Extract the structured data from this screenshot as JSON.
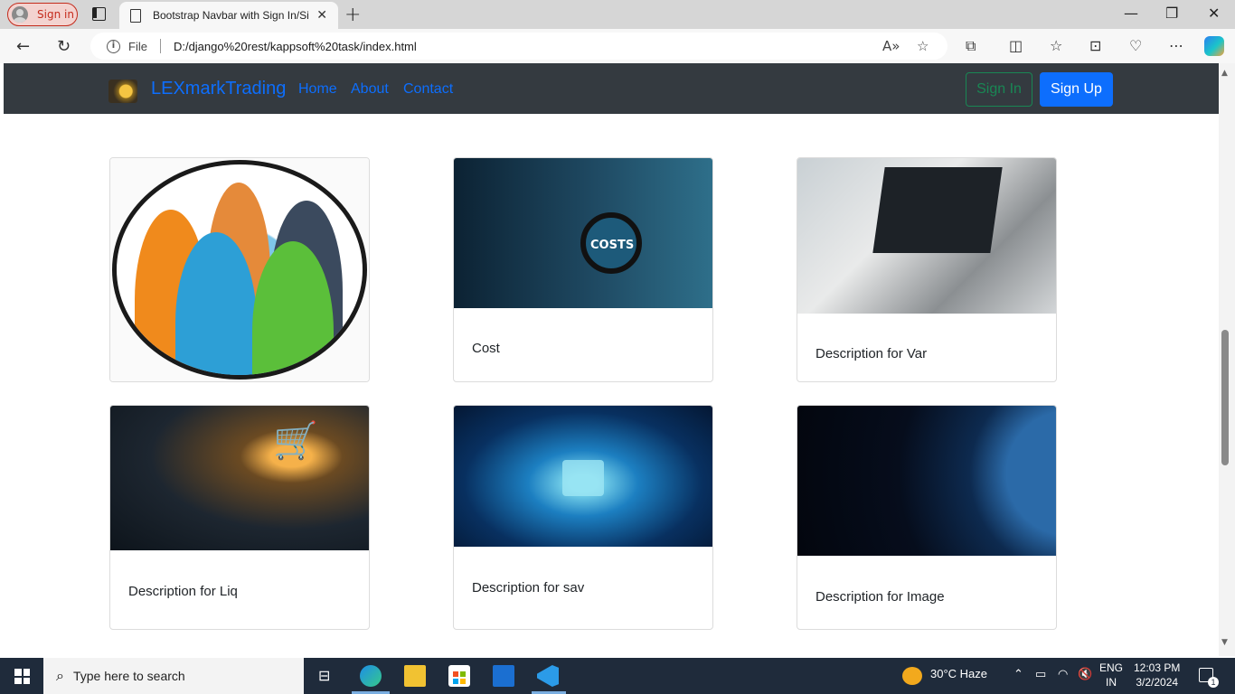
{
  "browser": {
    "profile_label": "Sign in",
    "tab_title": "Bootstrap Navbar with Sign In/Si",
    "address": {
      "scheme_label": "File",
      "url": "D:/django%20rest/kappsoft%20task/index.html"
    }
  },
  "navbar": {
    "brand": "LEXmarkTrading",
    "links": [
      "Home",
      "About",
      "Contact"
    ],
    "sign_in": "Sign In",
    "sign_up": "Sign Up"
  },
  "cards": [
    {
      "image": "people-group-icon",
      "text": ""
    },
    {
      "image": "costs-magnifier-photo",
      "text": "Cost"
    },
    {
      "image": "laptop-analytics-photo",
      "text": "Description for Var"
    },
    {
      "image": "digital-shopping-cart-photo",
      "text": "Description for Liq"
    },
    {
      "image": "digital-padlock-photo",
      "text": "Description for sav"
    },
    {
      "image": "earth-from-space-photo",
      "text": "Description for Image"
    }
  ],
  "image_overlay_text": {
    "costs": "COSTS"
  },
  "taskbar": {
    "search_placeholder": "Type here to search",
    "weather": "30°C  Haze",
    "lang_line1": "ENG",
    "lang_line2": "IN",
    "time": "12:03 PM",
    "date": "3/2/2024",
    "notification_count": "1"
  },
  "colors": {
    "navbar_bg": "#343a40",
    "primary": "#0d6efd",
    "success": "#198754",
    "taskbar_bg": "#1f2b3b"
  }
}
